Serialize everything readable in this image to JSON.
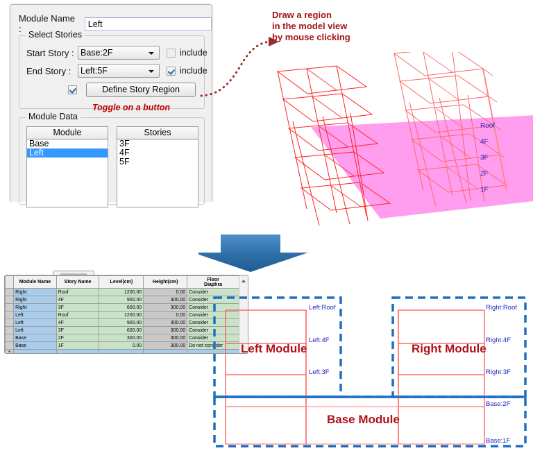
{
  "dialog": {
    "module_name_label": "Module Name :",
    "module_name_value": "Left",
    "select_stories": {
      "title": "Select Stories",
      "start_story_label": "Start Story :",
      "start_story_value": "Base:2F",
      "start_include_label": "include",
      "start_include_checked": false,
      "end_story_label": "End Story :",
      "end_story_value": "Left:5F",
      "end_include_label": "include",
      "end_include_checked": true,
      "define_toggle_checked": true,
      "define_button_label": "Define Story Region"
    },
    "module_data": {
      "title": "Module Data",
      "module_header": "Module",
      "stories_header": "Stories",
      "modules": [
        "Base",
        "Left"
      ],
      "selected_module": "Left",
      "stories": [
        "3F",
        "4F",
        "5F"
      ]
    }
  },
  "annotations": {
    "draw_region": [
      "Draw a region",
      "in the model view",
      "by mouse clicking"
    ],
    "toggle_button": "Toggle on a button"
  },
  "model_view": {
    "story_markers": [
      "Roof",
      "4F",
      "3F",
      "2F",
      "1F"
    ],
    "region_color": "#ff99ee",
    "frame_color": "#ff0000"
  },
  "grid": {
    "columns": [
      "Module Name",
      "Story Name",
      "Level(cm)",
      "Height(cm)",
      "Floor\nDiaphra"
    ],
    "columns_display": [
      "Module Name",
      "Story Name",
      "Level(cm)",
      "Height(cm)",
      "Floor"
    ],
    "floor_header_line1": "Floor",
    "floor_header_line2": "Diaphra",
    "new_row_marker": "*",
    "rows": [
      {
        "module": "Right",
        "story": "Roof",
        "level": "1200.00",
        "height": "0.00",
        "floor": "Consider"
      },
      {
        "module": "Right",
        "story": "4F",
        "level": "900.00",
        "height": "300.00",
        "floor": "Consider"
      },
      {
        "module": "Right",
        "story": "3F",
        "level": "600.00",
        "height": "300.00",
        "floor": "Consider"
      },
      {
        "module": "Left",
        "story": "Roof",
        "level": "1200.00",
        "height": "0.00",
        "floor": "Consider"
      },
      {
        "module": "Left",
        "story": "4F",
        "level": "900.00",
        "height": "300.00",
        "floor": "Consider"
      },
      {
        "module": "Left",
        "story": "3F",
        "level": "600.00",
        "height": "300.00",
        "floor": "Consider"
      },
      {
        "module": "Base",
        "story": "2F",
        "level": "300.00",
        "height": "300.00",
        "floor": "Consider"
      },
      {
        "module": "Base",
        "story": "1F",
        "level": "0.00",
        "height": "300.00",
        "floor": "Do not consider"
      }
    ]
  },
  "diagram": {
    "left_module_label": "Left Module",
    "right_module_label": "Right Module",
    "base_module_label": "Base Module",
    "left_story_labels": [
      "Left:Roof",
      "Left:4F",
      "Left:3F"
    ],
    "right_story_labels": [
      "Right:Roof",
      "Right:4F",
      "Right:3F"
    ],
    "base_story_labels": [
      "Base:2F",
      "Base:1F"
    ],
    "dash_color": "#1f6fc0",
    "frame_color": "#ff4444"
  },
  "colors": {
    "accent_red": "#b01116",
    "accent_blue": "#2222cc",
    "arrow_blue": "#2f6fae",
    "module_cell": "#a9cdeb",
    "story_cell": "#c9e3c9",
    "height_cell": "#c9c9c9"
  }
}
